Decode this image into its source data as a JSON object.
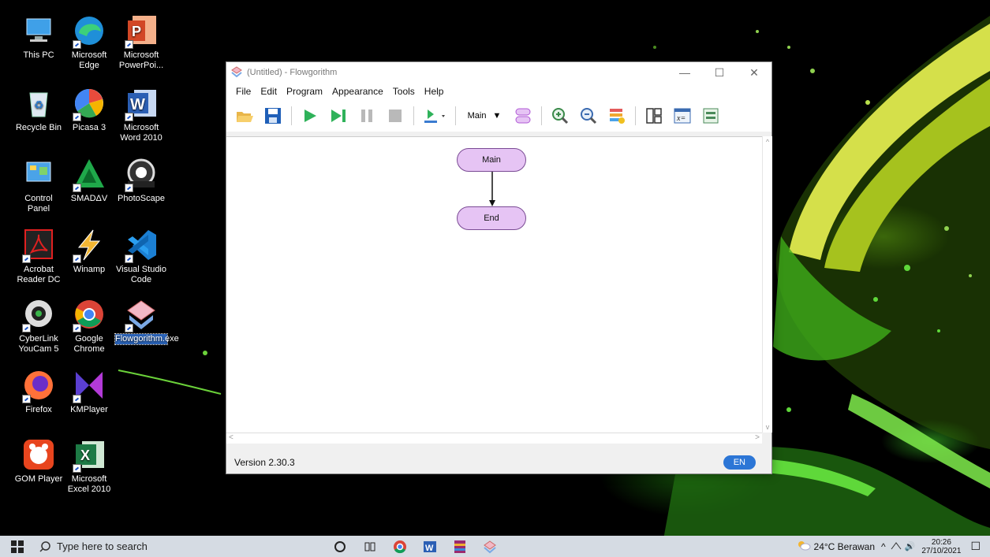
{
  "desktop": {
    "icons": [
      {
        "label": "This PC",
        "icon": "computer-icon"
      },
      {
        "label": "Microsoft Edge",
        "icon": "edge-icon"
      },
      {
        "label": "Microsoft PowerPoi...",
        "icon": "powerpoint-icon"
      },
      {
        "label": "Recycle Bin",
        "icon": "recycle-bin-icon"
      },
      {
        "label": "Picasa 3",
        "icon": "picasa-icon"
      },
      {
        "label": "Microsoft Word 2010",
        "icon": "word-icon"
      },
      {
        "label": "Control Panel",
        "icon": "control-panel-icon"
      },
      {
        "label": "SMADΔV",
        "icon": "smadav-icon"
      },
      {
        "label": "PhotoScape",
        "icon": "photoscape-icon"
      },
      {
        "label": "Acrobat Reader DC",
        "icon": "acrobat-icon"
      },
      {
        "label": "Winamp",
        "icon": "winamp-icon"
      },
      {
        "label": "Visual Studio Code",
        "icon": "vscode-icon"
      },
      {
        "label": "CyberLink YouCam 5",
        "icon": "youcam-icon"
      },
      {
        "label": "Google Chrome",
        "icon": "chrome-icon"
      },
      {
        "label": "Flowgorithm.exe",
        "icon": "flowgorithm-icon",
        "selected": true
      },
      {
        "label": "Firefox",
        "icon": "firefox-icon"
      },
      {
        "label": "KMPlayer",
        "icon": "kmplayer-icon"
      },
      {
        "label": "GOM Player",
        "icon": "gom-player-icon"
      },
      {
        "label": "Microsoft Excel 2010",
        "icon": "excel-icon"
      }
    ]
  },
  "window": {
    "title": "(Untitled) - Flowgorithm",
    "controls": {
      "minimize": "—",
      "maximize": "☐",
      "close": "✕"
    },
    "menu": [
      "File",
      "Edit",
      "Program",
      "Appearance",
      "Tools",
      "Help"
    ],
    "toolbar": {
      "function_select": "Main",
      "buttons": [
        "open-icon",
        "save-icon",
        "run-icon",
        "step-icon",
        "pause-icon",
        "stop-icon",
        "speed-icon",
        "function-icon",
        "zoom-in-icon",
        "zoom-out-icon",
        "style-icon",
        "layout-icon",
        "variables-icon",
        "console-icon"
      ]
    },
    "flowchart": {
      "start": "Main",
      "end": "End"
    },
    "scroll": {
      "up": "^",
      "down": "v",
      "left": "<",
      "right": ">"
    },
    "status": {
      "version": "Version 2.30.3",
      "language": "EN"
    }
  },
  "taskbar": {
    "search_placeholder": "Type here to search",
    "apps": [
      "cortana-icon",
      "task-view-icon",
      "chrome-icon",
      "word-icon",
      "winrar-icon",
      "flowgorithm-icon"
    ],
    "weather": "24°C Berawan",
    "time": "20:26",
    "date": "27/10/2021",
    "tray_symbols": {
      "chevron": "^",
      "volume": "🔊",
      "notification": "☐"
    }
  },
  "colors": {
    "accent": "#2c76d6",
    "node_fill": "#e6c4f4",
    "node_border": "#7a4b94",
    "taskbar": "#d5dbe3"
  }
}
